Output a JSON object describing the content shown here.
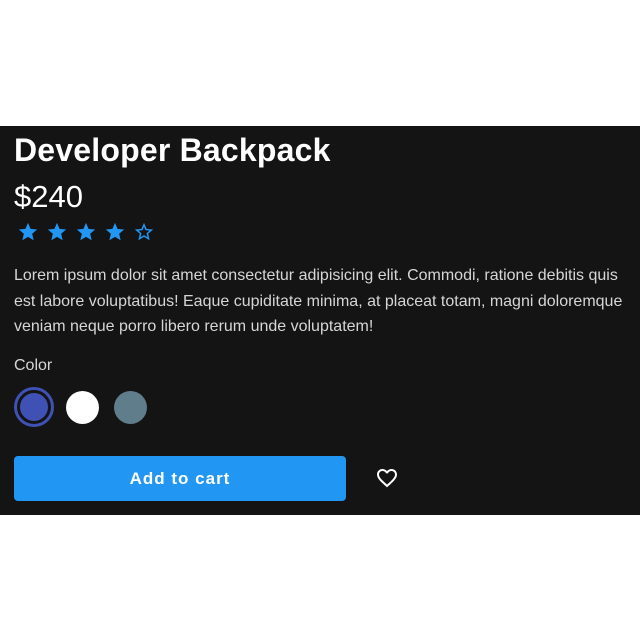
{
  "product": {
    "title": "Developer Backpack",
    "price": "$240",
    "rating": {
      "value": 4,
      "max": 5,
      "color": "#2196f3"
    },
    "description": "Lorem ipsum dolor sit amet consectetur adipisicing elit. Commodi, ratione debitis quis est labore voluptatibus! Eaque cupiditate minima, at placeat totam, magni doloremque veniam neque porro libero rerum unde voluptatem!"
  },
  "color_picker": {
    "label": "Color",
    "options": [
      {
        "name": "indigo",
        "hex": "#3f51b5",
        "selected": true
      },
      {
        "name": "white",
        "hex": "#ffffff",
        "selected": false
      },
      {
        "name": "slate",
        "hex": "#607d8b",
        "selected": false
      }
    ]
  },
  "actions": {
    "add_to_cart_label": "Add to cart",
    "button_color": "#2196f3",
    "favorite_icon": "heart-outline-icon"
  },
  "theme": {
    "card_background": "#141414",
    "page_background": "#ffffff"
  }
}
